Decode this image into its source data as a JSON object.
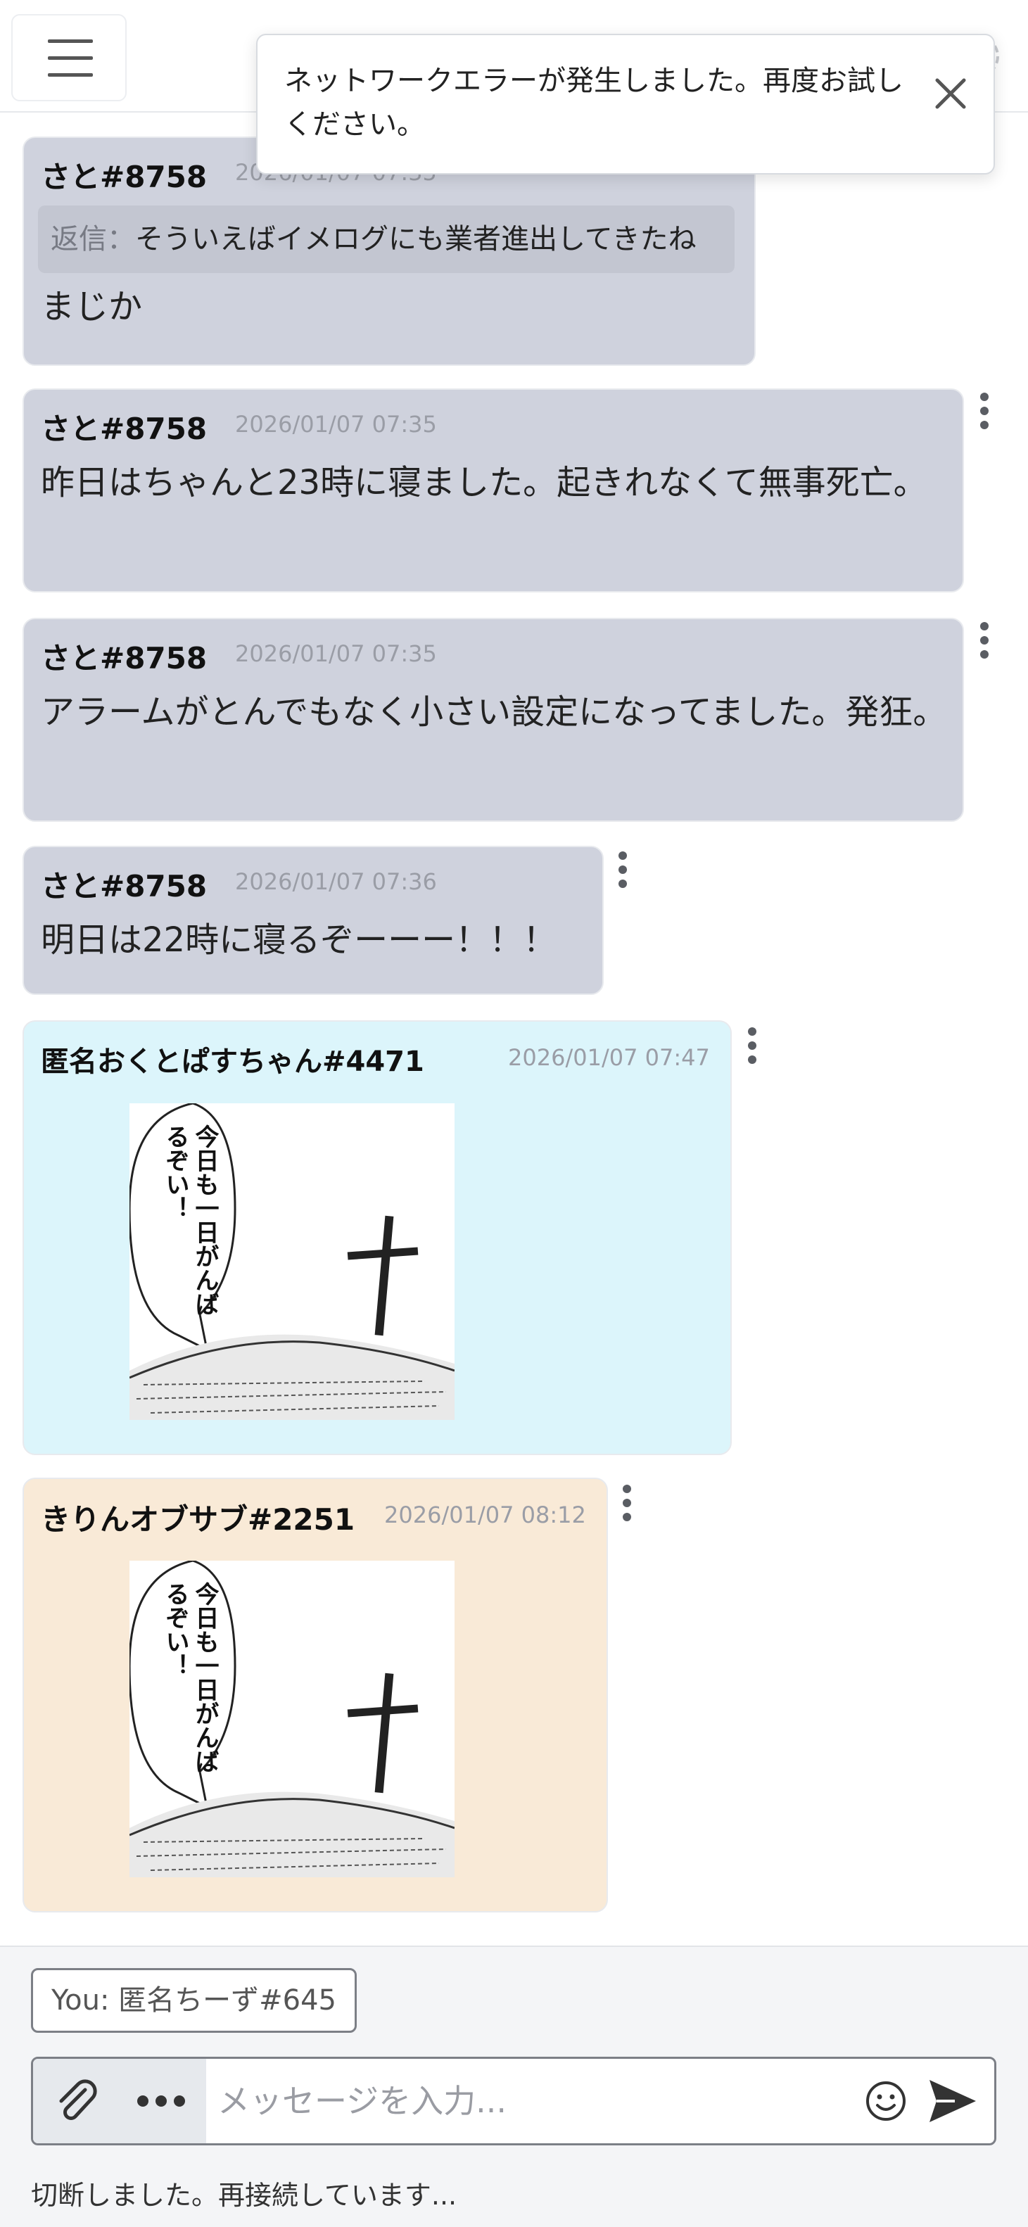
{
  "toast": {
    "message": "ネットワークエラーが発生しました。再度お試しください。"
  },
  "messages": [
    {
      "name": "さと#8758",
      "time": "2026/01/07 07:35",
      "reply_label": "返信：",
      "reply_text": "そういえばイメログにも業者進出してきたね",
      "body": "まじか",
      "color": "#cfd2dd"
    },
    {
      "name": "さと#8758",
      "time": "2026/01/07 07:35",
      "body": "昨日はちゃんと23時に寝ました。起きれなくて無事死亡。",
      "color": "#cfd2dd"
    },
    {
      "name": "さと#8758",
      "time": "2026/01/07 07:35",
      "body": "アラームがとんでもなく小さい設定になってました。発狂。",
      "color": "#cfd2dd"
    },
    {
      "name": "さと#8758",
      "time": "2026/01/07 07:36",
      "body": "明日は22時に寝るぞーーー！！！",
      "color": "#cfd2dd"
    },
    {
      "name": "匿名おくとぱすちゃん#4471",
      "time": "2026/01/07 07:47",
      "image_text": "今日も一日がんばるぞい！",
      "color": "#dcf5fb"
    },
    {
      "name": "きりんオブサブ#2251",
      "time": "2026/01/07 08:12",
      "image_text": "今日も一日がんばるぞい！",
      "color": "#f9ead7"
    }
  ],
  "footer": {
    "you_label": "You: 匿名ちーず#645",
    "input_placeholder": "メッセージを入力...",
    "status": "切断しました。再接続しています..."
  },
  "icons": [
    "menu-icon",
    "bell-icon",
    "ribbon-icon",
    "user-icon",
    "gear-icon",
    "close-icon",
    "kebab-icon",
    "paperclip-icon",
    "ellipsis-icon",
    "emoji-icon",
    "send-icon"
  ]
}
